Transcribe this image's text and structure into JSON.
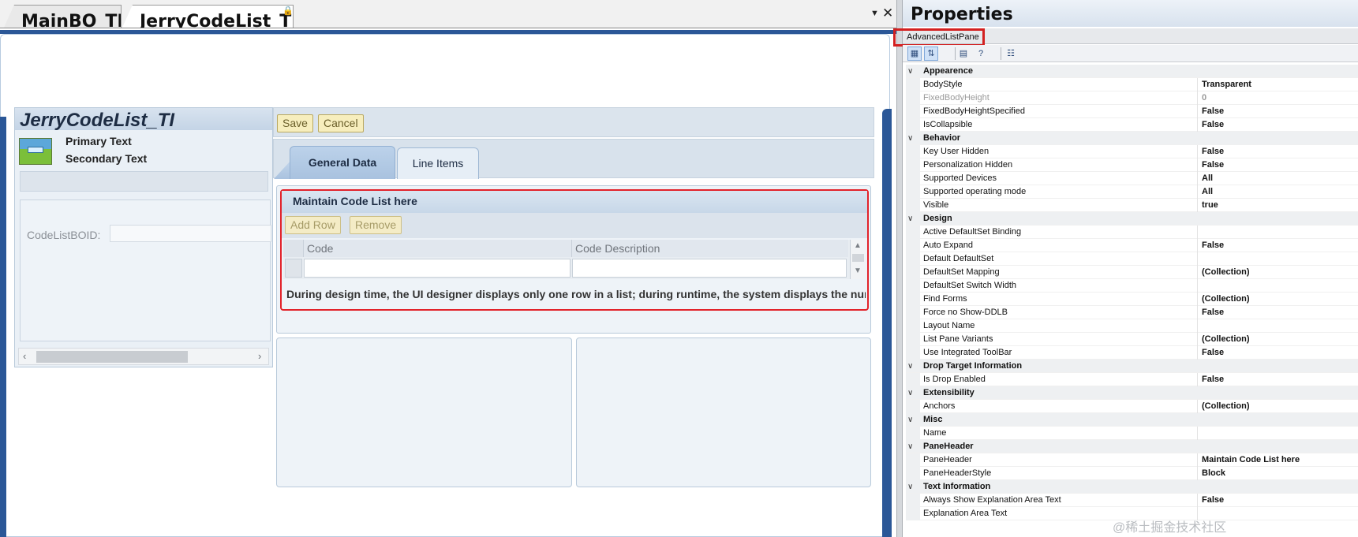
{
  "doc_tabs": [
    {
      "label": "MainBO_TI",
      "active": false
    },
    {
      "label": "JerryCodeList_TI",
      "active": true
    }
  ],
  "oip": {
    "title": "JerryCodeList_TI",
    "primary_text": "Primary Text",
    "secondary_text": "Secondary Text",
    "field_label": "CodeListBOID:"
  },
  "toolbar": {
    "save_label": "Save",
    "cancel_label": "Cancel"
  },
  "view_tabs": [
    {
      "label": "General Data",
      "active": true
    },
    {
      "label": "Line Items",
      "active": false
    }
  ],
  "list_pane": {
    "header": "Maintain Code List here",
    "add_row_label": "Add Row",
    "remove_label": "Remove",
    "columns": [
      "Code",
      "Code Description"
    ],
    "info_text": "During design time, the UI designer displays only one row in a list; during runtime, the system displays the num"
  },
  "properties": {
    "title": "Properties",
    "selected_object": "AdvancedListPane",
    "categories": [
      {
        "name": "Appearence",
        "rows": [
          {
            "name": "BodyStyle",
            "value": "Transparent"
          },
          {
            "name": "FixedBodyHeight",
            "value": "0",
            "disabled": true
          },
          {
            "name": "FixedBodyHeightSpecified",
            "value": "False"
          },
          {
            "name": "IsCollapsible",
            "value": "False"
          }
        ]
      },
      {
        "name": "Behavior",
        "rows": [
          {
            "name": "Key User Hidden",
            "value": "False"
          },
          {
            "name": "Personalization Hidden",
            "value": "False"
          },
          {
            "name": "Supported Devices",
            "value": "All"
          },
          {
            "name": "Supported operating mode",
            "value": "All"
          },
          {
            "name": "Visible",
            "value": "true"
          }
        ]
      },
      {
        "name": "Design",
        "rows": [
          {
            "name": "Active DefaultSet Binding",
            "value": ""
          },
          {
            "name": "Auto Expand",
            "value": "False"
          },
          {
            "name": "Default DefaultSet",
            "value": ""
          },
          {
            "name": "DefaultSet Mapping",
            "value": "(Collection)"
          },
          {
            "name": "DefaultSet Switch Width",
            "value": ""
          },
          {
            "name": "Find Forms",
            "value": "(Collection)"
          },
          {
            "name": "Force no Show-DDLB",
            "value": "False"
          },
          {
            "name": "Layout Name",
            "value": ""
          },
          {
            "name": "List Pane Variants",
            "value": "(Collection)"
          },
          {
            "name": "Use Integrated ToolBar",
            "value": "False"
          }
        ]
      },
      {
        "name": "Drop Target Information",
        "rows": [
          {
            "name": "Is Drop Enabled",
            "value": "False"
          }
        ]
      },
      {
        "name": "Extensibility",
        "rows": [
          {
            "name": "Anchors",
            "value": "(Collection)"
          }
        ]
      },
      {
        "name": "Misc",
        "rows": [
          {
            "name": "Name",
            "value": ""
          }
        ]
      },
      {
        "name": "PaneHeader",
        "rows": [
          {
            "name": "PaneHeader",
            "value": "Maintain Code List here"
          },
          {
            "name": "PaneHeaderStyle",
            "value": "Block"
          }
        ]
      },
      {
        "name": "Text Information",
        "rows": [
          {
            "name": "Always Show Explanation Area Text",
            "value": "False"
          },
          {
            "name": "Explanation Area Text",
            "value": ""
          }
        ]
      }
    ]
  },
  "watermark": "@稀土掘金技术社区",
  "icons": {
    "tab_pin": "pin-icon",
    "tab_dropdown": "chevron-down-icon",
    "tab_close": "close-icon",
    "categorized": "categorized-icon",
    "alphabetical": "sort-alphabetical-icon",
    "property_pages": "property-pages-icon",
    "help": "help-icon",
    "events": "events-icon"
  }
}
